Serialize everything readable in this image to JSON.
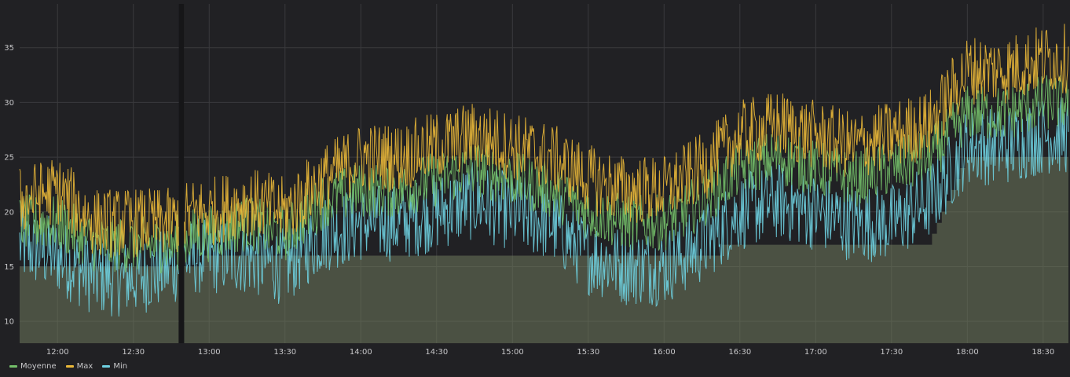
{
  "chart_data": {
    "type": "line",
    "title": "",
    "xlabel": "",
    "ylabel": "",
    "x_range": [
      "11:45",
      "18:40"
    ],
    "ylim": [
      8,
      39
    ],
    "y_ticks": [
      "10",
      "15",
      "20",
      "25",
      "30",
      "35"
    ],
    "x_ticks": [
      "12:00",
      "12:30",
      "13:00",
      "13:30",
      "14:00",
      "14:30",
      "15:00",
      "15:30",
      "16:00",
      "16:30",
      "17:00",
      "17:30",
      "18:00",
      "18:30"
    ],
    "grid": true,
    "legend_position": "bottom-left",
    "gap": [
      "12:48",
      "12:50"
    ],
    "series": [
      {
        "name": "Moyenne",
        "color": "#73bf69",
        "x": [
          "11:45",
          "12:00",
          "12:15",
          "12:30",
          "12:45",
          "12:55",
          "13:00",
          "13:15",
          "13:30",
          "13:45",
          "14:00",
          "14:15",
          "14:30",
          "14:45",
          "15:00",
          "15:15",
          "15:30",
          "15:45",
          "16:00",
          "16:15",
          "16:30",
          "16:45",
          "17:00",
          "17:15",
          "17:30",
          "17:45",
          "18:00",
          "18:15",
          "18:30",
          "18:40"
        ],
        "values": [
          19,
          19,
          17,
          17,
          17,
          18,
          18,
          19,
          18,
          21,
          22,
          22,
          23,
          24,
          23,
          22,
          20,
          19,
          19,
          21,
          24,
          25,
          24,
          23,
          24,
          25,
          29,
          29,
          30,
          30
        ]
      },
      {
        "name": "Max",
        "color": "#eab839",
        "x": [
          "11:45",
          "12:00",
          "12:15",
          "12:30",
          "12:45",
          "12:55",
          "13:00",
          "13:15",
          "13:30",
          "13:45",
          "14:00",
          "14:15",
          "14:30",
          "14:45",
          "15:00",
          "15:15",
          "15:30",
          "15:45",
          "16:00",
          "16:15",
          "16:30",
          "16:45",
          "17:00",
          "17:15",
          "17:30",
          "17:45",
          "18:00",
          "18:15",
          "18:30",
          "18:40"
        ],
        "values": [
          21,
          22,
          19,
          19,
          19,
          20,
          20,
          21,
          20,
          23,
          25,
          25,
          26,
          27,
          26,
          25,
          23,
          22,
          22,
          24,
          27,
          28,
          27,
          26,
          27,
          28,
          33,
          33,
          34,
          34
        ]
      },
      {
        "name": "Min",
        "color": "#6ed0e0",
        "x": [
          "11:45",
          "12:00",
          "12:15",
          "12:30",
          "12:45",
          "12:55",
          "13:00",
          "13:15",
          "13:30",
          "13:45",
          "14:00",
          "14:15",
          "14:30",
          "14:45",
          "15:00",
          "15:15",
          "15:30",
          "15:45",
          "16:00",
          "16:15",
          "16:30",
          "16:45",
          "17:00",
          "17:15",
          "17:30",
          "17:45",
          "18:00",
          "18:15",
          "18:30",
          "18:40"
        ],
        "values": [
          17,
          16,
          14,
          14,
          15,
          16,
          16,
          16,
          15,
          18,
          19,
          19,
          20,
          21,
          20,
          19,
          16,
          15,
          15,
          17,
          20,
          21,
          20,
          19,
          19,
          21,
          26,
          26,
          27,
          27
        ],
        "floor_values": [
          15,
          15,
          15,
          15,
          15,
          15,
          16,
          16,
          16,
          16,
          16,
          16,
          16,
          16,
          16,
          16,
          16,
          16,
          16,
          16,
          17,
          17,
          17,
          17,
          17,
          17,
          25,
          25,
          25,
          25
        ]
      }
    ]
  }
}
